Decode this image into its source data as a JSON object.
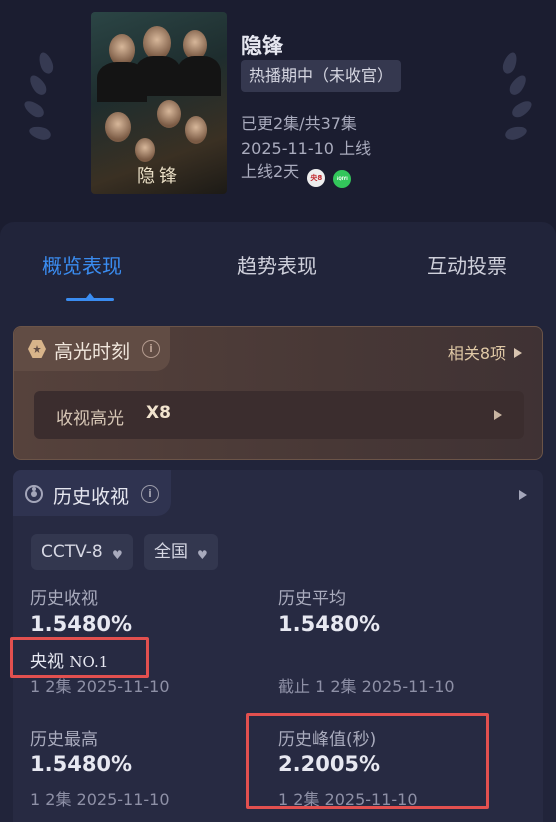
{
  "show": {
    "title": "隐锋",
    "status": "热播期中（未收官）",
    "episodes": "已更2集/共37集",
    "air_date": "2025-11-10 上线",
    "days_online": "上线2天",
    "poster_title": "隐锋",
    "channels": [
      {
        "name": "cctv-8-icon",
        "label": "央8"
      },
      {
        "name": "iqiyi-icon",
        "label": "iQIYI"
      }
    ]
  },
  "tabs": [
    {
      "label": "概览表现",
      "active": true
    },
    {
      "label": "趋势表现",
      "active": false
    },
    {
      "label": "互动投票",
      "active": false
    }
  ],
  "highlight": {
    "title": "高光时刻",
    "related": "相关8项",
    "row_label": "收视高光",
    "row_value": "X8"
  },
  "history": {
    "title": "历史收视",
    "channel": "CCTV-8",
    "region": "全国",
    "stats": {
      "history_rating": {
        "label": "历史收视",
        "value": "1.5480%",
        "rank_prefix": "央视",
        "rank": "NO.1",
        "sub": "1 2集 2025-11-10"
      },
      "history_avg": {
        "label": "历史平均",
        "value": "1.5480%",
        "sub": "截止 1 2集 2025-11-10"
      },
      "history_high": {
        "label": "历史最高",
        "value": "1.5480%",
        "sub": "1 2集 2025-11-10"
      },
      "history_peak": {
        "label": "历史峰值(秒)",
        "value": "2.2005%",
        "sub": "1 2集 2025-11-10"
      }
    }
  },
  "colors": {
    "accent": "#3a8cf0",
    "highlight_box": "#e2504f",
    "background": "#1b1d30"
  }
}
